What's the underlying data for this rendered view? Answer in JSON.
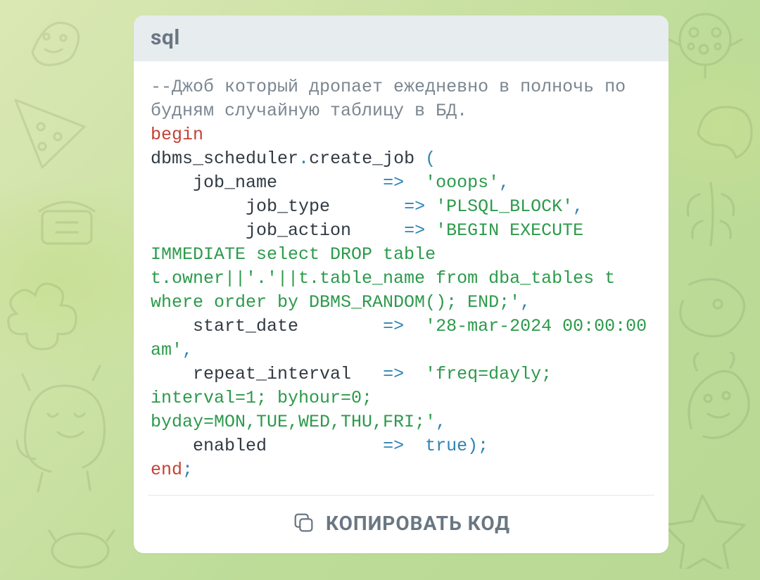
{
  "header": {
    "title": "sql"
  },
  "code": {
    "comment": "--Джоб который дропает ежедневно в полночь по будням случайную таблицу в БД.",
    "begin": "begin",
    "scheduler": "dbms_scheduler",
    "dot": ".",
    "create_job": "create_job",
    "open_paren": " (",
    "job_name_label": "    job_name          ",
    "arrow": "=>",
    "job_name_value": "'ooops'",
    "comma": ",",
    "job_type_label": "         job_type       ",
    "job_type_value": "'PLSQL_BLOCK'",
    "job_action_label": "         job_action     ",
    "job_action_value": "'BEGIN EXECUTE IMMEDIATE select DROP table t.owner||'.'||t.table_name from dba_tables t where order by DBMS_RANDOM(); END;'",
    "start_date_label": "    start_date        ",
    "start_date_value": "'28-mar-2024 00:00:00 am'",
    "repeat_interval_label": "    repeat_interval   ",
    "repeat_interval_value": "'freq=dayly; interval=1; byhour=0; byday=MON,TUE,WED,THU,FRI;'",
    "enabled_label": "    enabled           ",
    "true_value": "true",
    "close_paren": ")",
    "semicolon": ";",
    "end": "end"
  },
  "copy": {
    "label": "КОПИРОВАТЬ КОД"
  }
}
